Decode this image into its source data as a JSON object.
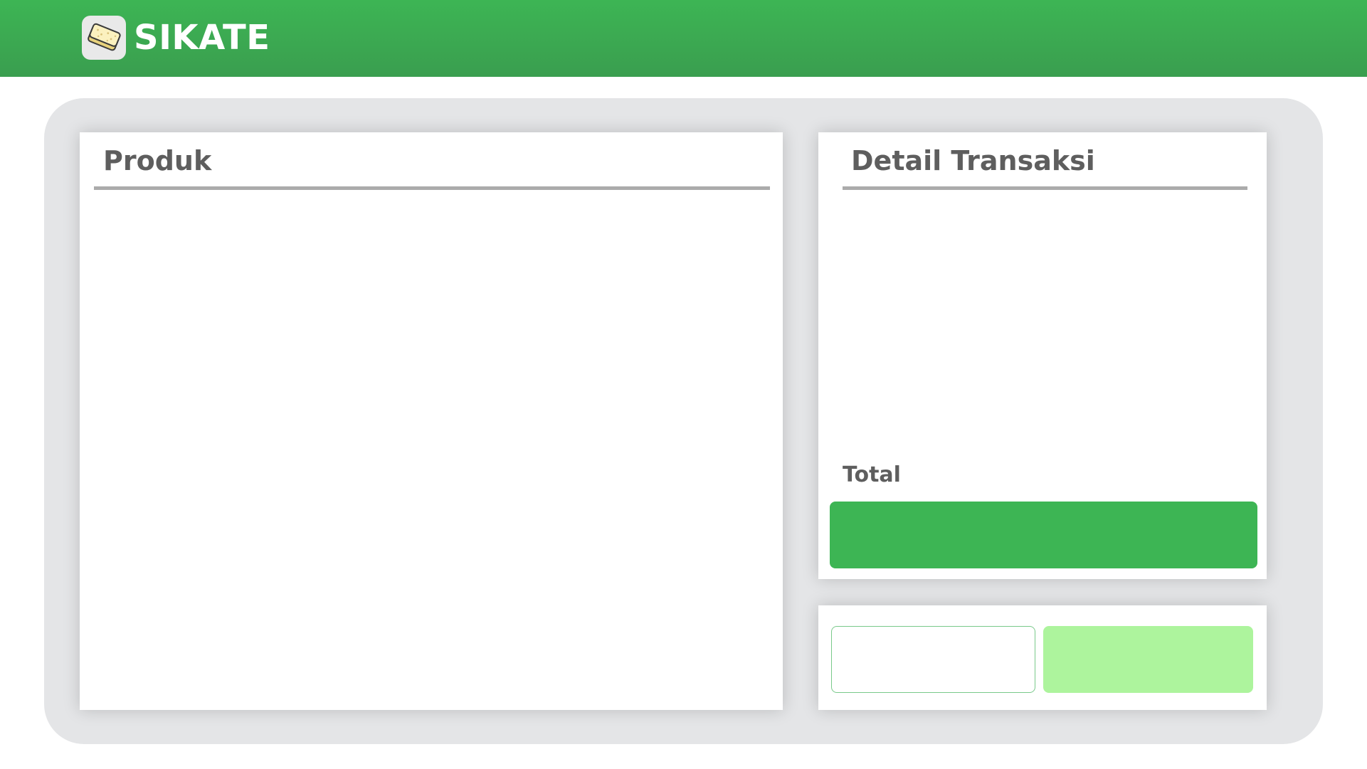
{
  "brand": {
    "name": "SIKATE",
    "logo_icon": "tempe-icon"
  },
  "colors": {
    "primary_green": "#3db554",
    "light_green": "#adf49d",
    "wrapper_gray": "#e4e5e7",
    "heading_gray": "#5e5e5e"
  },
  "produk_panel": {
    "title": "Produk"
  },
  "detail_panel": {
    "title": "Detail Transaksi",
    "total_label": "Total",
    "total_value": ""
  },
  "actions": {
    "secondary_label": "",
    "primary_label": ""
  }
}
